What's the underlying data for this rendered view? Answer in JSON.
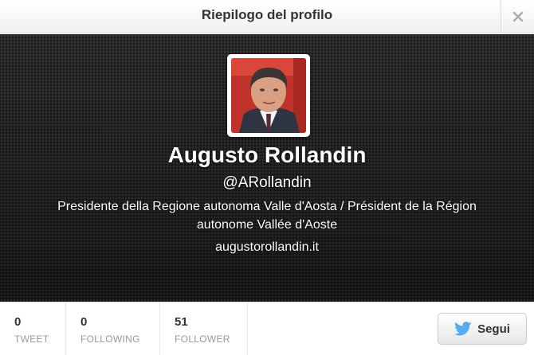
{
  "dialog": {
    "title": "Riepilogo del profilo",
    "close_icon": "close-x-icon"
  },
  "profile": {
    "name": "Augusto Rollandin",
    "screen_name": "@ARollandin",
    "bio": "Presidente della Regione autonoma Valle d'Aosta / Président de la Région autonome Vallée d'Aoste",
    "url": "augustorollandin.it",
    "avatar_icon": "profile-photo"
  },
  "stats": [
    {
      "value": "0",
      "label": "TWEET"
    },
    {
      "value": "0",
      "label": "FOLLOWING"
    },
    {
      "value": "51",
      "label": "FOLLOWER"
    }
  ],
  "follow_button": {
    "label": "Segui",
    "icon": "twitter-bird-icon",
    "icon_color": "#55acee"
  },
  "colors": {
    "header_background": "#1f1f1f",
    "avatar_background": "#c0322a"
  }
}
